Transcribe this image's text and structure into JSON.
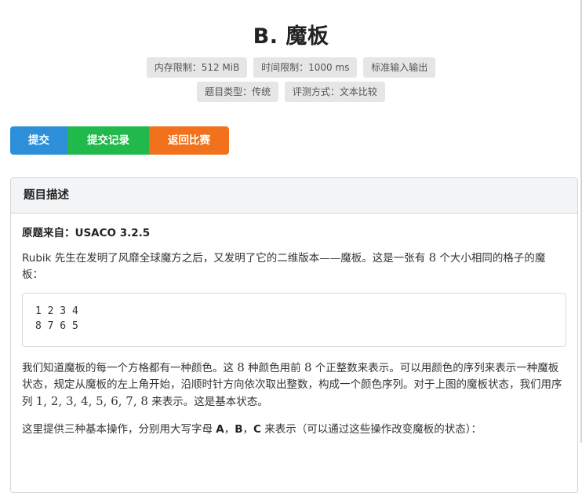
{
  "problem": {
    "title": "B. 魔板",
    "badges_row1": [
      "内存限制：512 MiB",
      "时间限制：1000 ms",
      "标准输入输出"
    ],
    "badges_row2": [
      "题目类型：传统",
      "评测方式：文本比较"
    ]
  },
  "actions": {
    "submit": "提交",
    "records": "提交记录",
    "back": "返回比赛",
    "colors": {
      "submit": "#2d8fd7",
      "records": "#21b94b",
      "back": "#f2711c"
    }
  },
  "description": {
    "header": "题目描述",
    "source": "原题来自：USACO 3.2.5",
    "para1": {
      "before": "Rubik 先生在发明了风靡全球魔方之后，又发明了它的二维版本——魔板。这是一张有 ",
      "math": "8",
      "after": " 个大小相同的格子的魔板："
    },
    "code_lines": [
      "1 2 3 4",
      "8 7 6 5"
    ],
    "para2": {
      "t1": "我们知道魔板的每一个方格都有一种颜色。这 ",
      "m1": "8",
      "t2": " 种颜色用前 ",
      "m2": "8",
      "t3": " 个正整数来表示。可以用颜色的序列来表示一种魔板状态，规定从魔板的左上角开始，沿顺时针方向依次取出整数，构成一个颜色序列。对于上图的魔板状态，我们用序列 ",
      "m3": "1, 2, 3, 4, 5, 6, 7, 8",
      "t4": " 来表示。这是基本状态。"
    },
    "para3": {
      "t1": "这里提供三种基本操作，分别用大写字母 ",
      "a": "A",
      "sep1": "，",
      "b": "B",
      "sep2": "，",
      "c": "C",
      "t2": " 来表示（可以通过这些操作改变魔板的状态）："
    }
  }
}
